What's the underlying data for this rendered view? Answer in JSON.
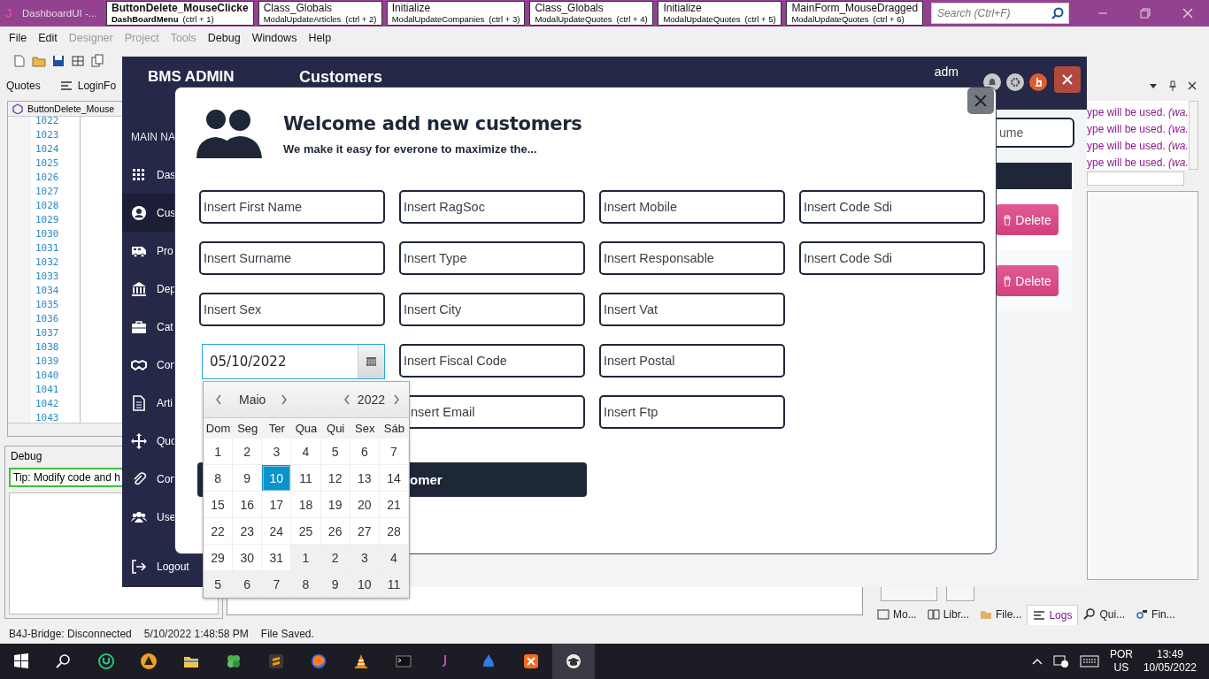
{
  "ide": {
    "title_bar": {
      "logo": "J",
      "title": "DashboardUI -...",
      "tabs": [
        {
          "title": "ButtonDelete_MouseClicke",
          "module": "DashBoardMenu",
          "shortcut": "(ctrl + 1)",
          "selected": true
        },
        {
          "title": "Class_Globals",
          "module": "ModalUpdateArticles",
          "shortcut": "(ctrl + 2)",
          "selected": false
        },
        {
          "title": "Initialize",
          "module": "ModalUpdateCompanies",
          "shortcut": "(ctrl + 3)",
          "selected": false
        },
        {
          "title": "Class_Globals",
          "module": "ModalUpdateQuotes",
          "shortcut": "(ctrl + 4)",
          "selected": false
        },
        {
          "title": "Initialize",
          "module": "ModalUpdateQuotes",
          "shortcut": "(ctrl + 5)",
          "selected": false
        },
        {
          "title": "MainForm_MouseDragged",
          "module": "ModalUpdateQuotes",
          "shortcut": "(ctrl + 6)",
          "selected": false
        }
      ],
      "search": {
        "placeholder": "Search (Ctrl+F)"
      }
    },
    "menu": [
      {
        "label": "File",
        "disabled": false
      },
      {
        "label": "Edit",
        "disabled": false
      },
      {
        "label": "Designer",
        "disabled": true
      },
      {
        "label": "Project",
        "disabled": true
      },
      {
        "label": "Tools",
        "disabled": true
      },
      {
        "label": "Debug",
        "disabled": false
      },
      {
        "label": "Windows",
        "disabled": false
      },
      {
        "label": "Help",
        "disabled": false
      }
    ],
    "doc_tabs": [
      "Quotes",
      "LoginFo"
    ],
    "editor": {
      "tab": "ButtonDelete_Mouse",
      "line_numbers": [
        "1022",
        "1023",
        "1024",
        "1025",
        "1026",
        "1027",
        "1028",
        "1029",
        "1030",
        "1031",
        "1032",
        "1033",
        "1034",
        "1035",
        "1036",
        "1037",
        "1038",
        "1039",
        "1040",
        "1041",
        "1042",
        "1043"
      ]
    },
    "debug": {
      "title": "Debug",
      "tip": "Tip: Modify code and h"
    },
    "logs": [
      "ype will be used. *(wa.*",
      "ype will be used. *(wa.*",
      "ype will be used. *(wa.*",
      "ype will be used. *(wa.*"
    ],
    "bottom_tabs": [
      {
        "label": "Mo...",
        "selected": false
      },
      {
        "label": "Libr...",
        "selected": false
      },
      {
        "label": "File...",
        "selected": false
      },
      {
        "label": "Logs",
        "selected": true
      },
      {
        "label": "Qui...",
        "selected": false
      },
      {
        "label": "Fin...",
        "selected": false
      }
    ],
    "status_bar": [
      "B4J-Bridge: Disconnected",
      "5/10/2022 1:48:58 PM",
      "File Saved."
    ]
  },
  "app": {
    "brand": "BMS ADMIN",
    "page_title": "Customers",
    "user": "adm",
    "nav_heading": "MAIN NA",
    "nav": [
      {
        "label": "Das",
        "selected": false
      },
      {
        "label": "Cus",
        "selected": true
      },
      {
        "label": "Pro",
        "selected": false
      },
      {
        "label": "Dep",
        "selected": false
      },
      {
        "label": "Cat",
        "selected": false
      },
      {
        "label": "Con",
        "selected": false
      },
      {
        "label": "Arti",
        "selected": false
      },
      {
        "label": "Quo",
        "selected": false
      },
      {
        "label": "Con",
        "selected": false
      },
      {
        "label": "Use",
        "selected": false
      },
      {
        "label": "Logout",
        "selected": false
      }
    ],
    "search": {
      "placeholder": "ume"
    },
    "rows": [
      {
        "action": "Delete"
      },
      {
        "action": "Delete"
      }
    ]
  },
  "modal": {
    "title": "Welcome add new customers",
    "subtitle": "We make it easy for everone to maximize the...",
    "columns": [
      [
        {
          "kind": "text",
          "placeholder": "Insert First Name"
        },
        {
          "kind": "text",
          "placeholder": "Insert Surname"
        },
        {
          "kind": "text",
          "placeholder": "Insert Sex"
        },
        {
          "kind": "date",
          "value": "05/10/2022"
        }
      ],
      [
        {
          "kind": "text",
          "placeholder": "Insert RagSoc"
        },
        {
          "kind": "text",
          "placeholder": "Insert Type"
        },
        {
          "kind": "text",
          "placeholder": "Insert City"
        },
        {
          "kind": "text",
          "placeholder": "Insert Fiscal Code"
        },
        {
          "kind": "text",
          "placeholder": "nsert Email"
        }
      ],
      [
        {
          "kind": "text",
          "placeholder": "Insert Mobile"
        },
        {
          "kind": "text",
          "placeholder": "Insert Responsable"
        },
        {
          "kind": "text",
          "placeholder": "Insert Vat"
        },
        {
          "kind": "text",
          "placeholder": "Insert Postal"
        },
        {
          "kind": "text",
          "placeholder": "Insert Ftp"
        }
      ],
      [
        {
          "kind": "text",
          "placeholder": "Insert Code Sdi"
        },
        {
          "kind": "text",
          "placeholder": "Insert Code Sdi"
        }
      ]
    ],
    "submit_button": "omer",
    "calendar": {
      "month": "Maio",
      "year": "2022",
      "weekdays": [
        "Dom",
        "Seg",
        "Ter",
        "Qua",
        "Qui",
        "Sex",
        "Sáb"
      ],
      "weeks": [
        [
          {
            "day": "1",
            "in_month": true,
            "selected": false
          },
          {
            "day": "2",
            "in_month": true,
            "selected": false
          },
          {
            "day": "3",
            "in_month": true,
            "selected": false
          },
          {
            "day": "4",
            "in_month": true,
            "selected": false
          },
          {
            "day": "5",
            "in_month": true,
            "selected": false
          },
          {
            "day": "6",
            "in_month": true,
            "selected": false
          },
          {
            "day": "7",
            "in_month": true,
            "selected": false
          }
        ],
        [
          {
            "day": "8",
            "in_month": true,
            "selected": false
          },
          {
            "day": "9",
            "in_month": true,
            "selected": false
          },
          {
            "day": "10",
            "in_month": true,
            "selected": true
          },
          {
            "day": "11",
            "in_month": true,
            "selected": false
          },
          {
            "day": "12",
            "in_month": true,
            "selected": false
          },
          {
            "day": "13",
            "in_month": true,
            "selected": false
          },
          {
            "day": "14",
            "in_month": true,
            "selected": false
          }
        ],
        [
          {
            "day": "15",
            "in_month": true,
            "selected": false
          },
          {
            "day": "16",
            "in_month": true,
            "selected": false
          },
          {
            "day": "17",
            "in_month": true,
            "selected": false
          },
          {
            "day": "18",
            "in_month": true,
            "selected": false
          },
          {
            "day": "19",
            "in_month": true,
            "selected": false
          },
          {
            "day": "20",
            "in_month": true,
            "selected": false
          },
          {
            "day": "21",
            "in_month": true,
            "selected": false
          }
        ],
        [
          {
            "day": "22",
            "in_month": true,
            "selected": false
          },
          {
            "day": "23",
            "in_month": true,
            "selected": false
          },
          {
            "day": "24",
            "in_month": true,
            "selected": false
          },
          {
            "day": "25",
            "in_month": true,
            "selected": false
          },
          {
            "day": "26",
            "in_month": true,
            "selected": false
          },
          {
            "day": "27",
            "in_month": true,
            "selected": false
          },
          {
            "day": "28",
            "in_month": true,
            "selected": false
          }
        ],
        [
          {
            "day": "29",
            "in_month": true,
            "selected": false
          },
          {
            "day": "30",
            "in_month": true,
            "selected": false
          },
          {
            "day": "31",
            "in_month": true,
            "selected": false
          },
          {
            "day": "1",
            "in_month": false,
            "selected": false
          },
          {
            "day": "2",
            "in_month": false,
            "selected": false
          },
          {
            "day": "3",
            "in_month": false,
            "selected": false
          },
          {
            "day": "4",
            "in_month": false,
            "selected": false
          }
        ],
        [
          {
            "day": "5",
            "in_month": false,
            "selected": false
          },
          {
            "day": "6",
            "in_month": false,
            "selected": false
          },
          {
            "day": "7",
            "in_month": false,
            "selected": false
          },
          {
            "day": "8",
            "in_month": false,
            "selected": false
          },
          {
            "day": "9",
            "in_month": false,
            "selected": false
          },
          {
            "day": "10",
            "in_month": false,
            "selected": false
          },
          {
            "day": "11",
            "in_month": false,
            "selected": false
          }
        ]
      ]
    }
  },
  "taskbar": {
    "language": "POR",
    "layout": "US",
    "time": "13:49",
    "date": "10/05/2022"
  }
}
